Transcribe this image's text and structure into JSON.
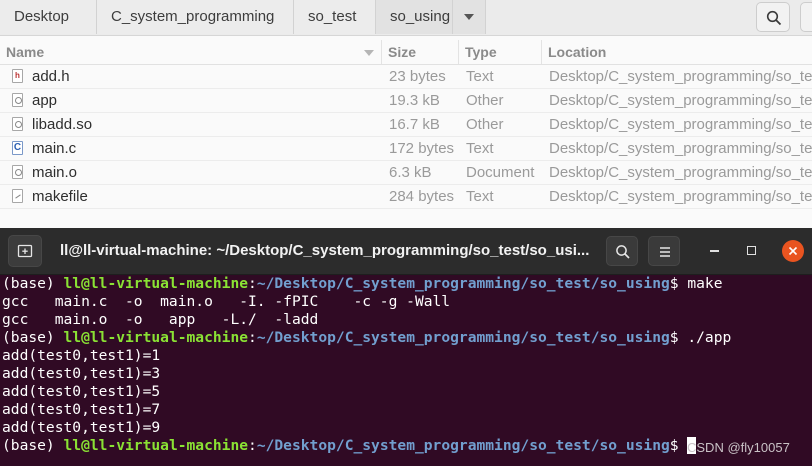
{
  "file_manager": {
    "breadcrumbs": [
      "Desktop",
      "C_system_programming",
      "so_test",
      "so_using"
    ],
    "columns": {
      "name": "Name",
      "size": "Size",
      "type": "Type",
      "location": "Location"
    },
    "files": [
      {
        "icon": "header-file-icon",
        "name": "add.h",
        "size": "23 bytes",
        "type": "Text",
        "location": "Desktop/C_system_programming/so_te"
      },
      {
        "icon": "executable-file-icon",
        "name": "app",
        "size": "19.3 kB",
        "type": "Other",
        "location": "Desktop/C_system_programming/so_te"
      },
      {
        "icon": "library-file-icon",
        "name": "libadd.so",
        "size": "16.7 kB",
        "type": "Other",
        "location": "Desktop/C_system_programming/so_te"
      },
      {
        "icon": "c-source-file-icon",
        "name": "main.c",
        "size": "172 bytes",
        "type": "Text",
        "location": "Desktop/C_system_programming/so_te"
      },
      {
        "icon": "object-file-icon",
        "name": "main.o",
        "size": "6.3 kB",
        "type": "Document",
        "location": "Desktop/C_system_programming/so_te"
      },
      {
        "icon": "text-file-icon",
        "name": "makefile",
        "size": "284 bytes",
        "type": "Text",
        "location": "Desktop/C_system_programming/so_te"
      }
    ]
  },
  "terminal": {
    "title": "ll@ll-virtual-machine: ~/Desktop/C_system_programming/so_test/so_usi...",
    "prompt": {
      "env": "(base) ",
      "user": "ll@ll-virtual-machine",
      "sep": ":",
      "path": "~/Desktop/C_system_programming/so_test/so_using",
      "dollar": "$ "
    },
    "commands": [
      "make",
      "./app",
      ""
    ],
    "make_output": [
      "gcc   main.c  -o  main.o   -I. -fPIC    -c -g -Wall",
      "gcc   main.o  -o   app   -L./  -ladd"
    ],
    "app_output": [
      "add(test0,test1)=1",
      "add(test0,test1)=3",
      "add(test0,test1)=5",
      "add(test0,test1)=7",
      "add(test0,test1)=9"
    ]
  },
  "watermark": "CSDN @fly10057",
  "colors": {
    "terminal_bg": "#300a24",
    "prompt_user": "#8ae234",
    "prompt_path": "#729fcf",
    "close_button": "#e95420"
  }
}
